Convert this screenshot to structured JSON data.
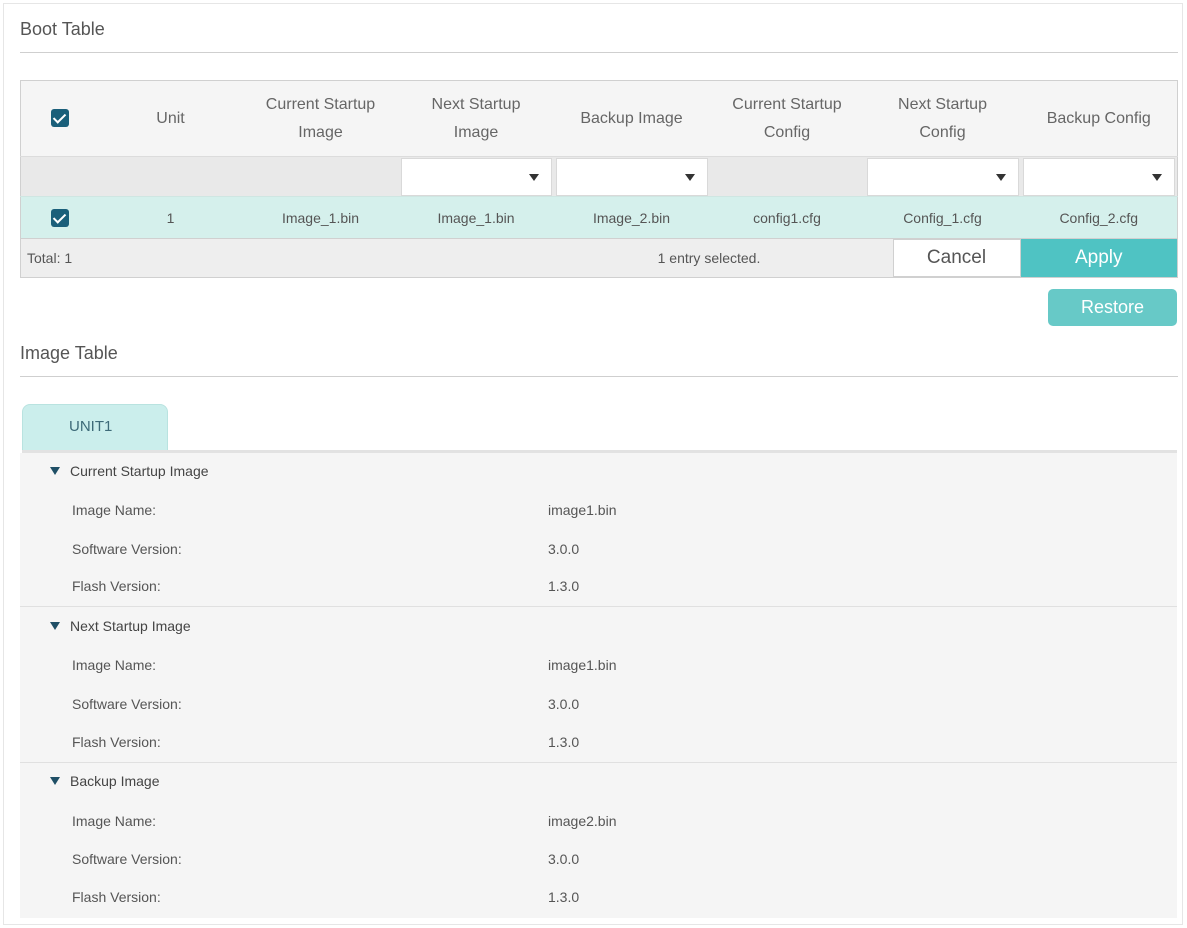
{
  "boot_table": {
    "title": "Boot Table",
    "columns": [
      "Unit",
      "Current Startup\nImage",
      "Next Startup\nImage",
      "Backup Image",
      "Current Startup\nConfig",
      "Next Startup\nConfig",
      "Backup Config"
    ],
    "row": {
      "unit": "1",
      "current_startup_image": "Image_1.bin",
      "next_startup_image": "Image_1.bin",
      "backup_image": "Image_2.bin",
      "current_startup_config": "config1.cfg",
      "next_startup_config": "Config_1.cfg",
      "backup_config": "Config_2.cfg"
    },
    "footer": {
      "total": "Total: 1",
      "selection": "1 entry selected.",
      "cancel_label": "Cancel",
      "apply_label": "Apply"
    },
    "restore_label": "Restore"
  },
  "image_table": {
    "title": "Image Table",
    "tab_label": "UNIT1",
    "groups": [
      {
        "title": "Current Startup Image",
        "fields": [
          {
            "label": "Image Name:",
            "value": "image1.bin"
          },
          {
            "label": "Software Version:",
            "value": "3.0.0"
          },
          {
            "label": "Flash Version:",
            "value": "1.3.0"
          }
        ]
      },
      {
        "title": "Next Startup Image",
        "fields": [
          {
            "label": "Image Name:",
            "value": "image1.bin"
          },
          {
            "label": "Software Version:",
            "value": "3.0.0"
          },
          {
            "label": "Flash Version:",
            "value": "1.3.0"
          }
        ]
      },
      {
        "title": "Backup Image",
        "fields": [
          {
            "label": "Image Name:",
            "value": "image2.bin"
          },
          {
            "label": "Software Version:",
            "value": "3.0.0"
          },
          {
            "label": "Flash Version:",
            "value": "1.3.0"
          }
        ]
      }
    ]
  },
  "colors": {
    "accent": "#4fc3c3",
    "selected_row": "#d5f0ec",
    "checkbox": "#1a5f7a"
  }
}
